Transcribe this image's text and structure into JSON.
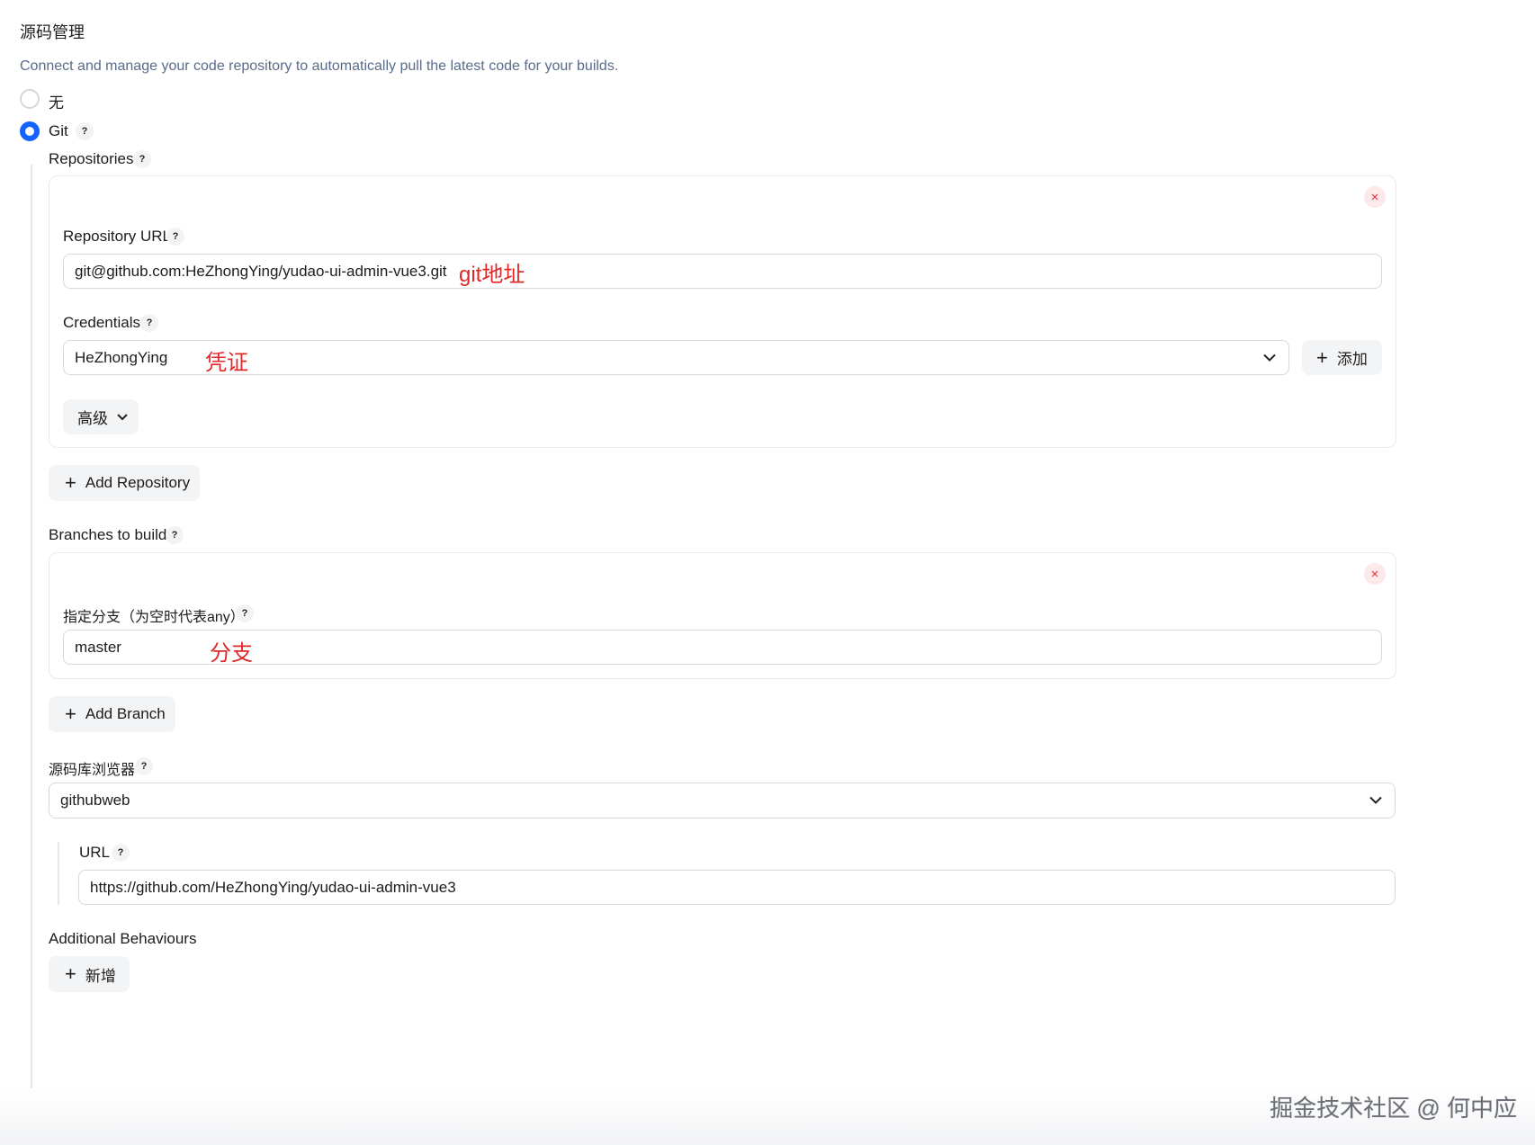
{
  "section": {
    "title": "源码管理",
    "description": "Connect and manage your code repository to automatically pull the latest code for your builds."
  },
  "scm_options": [
    {
      "label": "无",
      "selected": false
    },
    {
      "label": "Git",
      "selected": true
    }
  ],
  "help_symbol": "?",
  "close_symbol": "×",
  "plus_symbol": "+",
  "repositories": {
    "label": "Repositories",
    "repo_url_label": "Repository URL",
    "repo_url_value": "git@github.com:HeZhongYing/yudao-ui-admin-vue3.git",
    "repo_url_annotation": "git地址",
    "credentials_label": "Credentials",
    "credentials_value": "HeZhongYing",
    "credentials_annotation": "凭证",
    "add_credentials_label": "添加",
    "advanced_label": "高级",
    "add_repository_label": "Add Repository"
  },
  "branches": {
    "label": "Branches to build",
    "branch_spec_label": "指定分支（为空时代表any）",
    "branch_value": "master",
    "branch_annotation": "分支",
    "add_branch_label": "Add Branch"
  },
  "browser": {
    "label": "源码库浏览器",
    "value": "githubweb",
    "url_label": "URL",
    "url_value": "https://github.com/HeZhongYing/yudao-ui-admin-vue3"
  },
  "behaviours": {
    "label": "Additional Behaviours",
    "add_label": "新增"
  },
  "watermark": "掘金技术社区 @ 何中应",
  "colors": {
    "accent": "#1463ff",
    "annotation": "#e02a2a",
    "remove": "#e0303c"
  },
  "icons": {
    "dropdown": "chevron-down-icon",
    "remove": "close-icon",
    "add": "plus-icon",
    "help": "help-icon"
  }
}
